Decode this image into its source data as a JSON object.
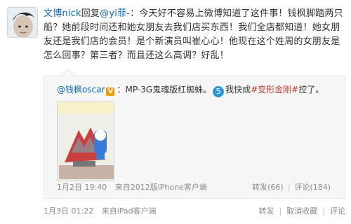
{
  "post": {
    "author": "文博nick",
    "reply_label": "回复",
    "reply_to": "@yi菲-",
    "content": "：今天好不容易上微博知道了这件事！钱枫脚踏两只船？她前段时间还和她女朋友去我们店买东西！我们全店都知道！她女朋友还是我们店的会员！是个新演员叫崔心心！他现在这个姓周的女朋友是怎么回事？第三者？而且还这么高调？好乱！"
  },
  "quote": {
    "author": "@钱枫oscar",
    "verified_badge": "V",
    "text_1": "：MP-3G鬼魂版红蜘蛛。",
    "icon_text": "5",
    "text_2": "我快成",
    "link_text": "#变形金刚#",
    "text_3": "控了。",
    "time": "1月2日 19:40",
    "source": "来自2012版iPhone客户端",
    "repost": "转发(66)",
    "comment": "评论(184)"
  },
  "bottom": {
    "time": "1月3日 01:22",
    "source": "来自iPad客户端",
    "repost": "转发",
    "favorite": "取消收藏",
    "comment": "评论"
  }
}
